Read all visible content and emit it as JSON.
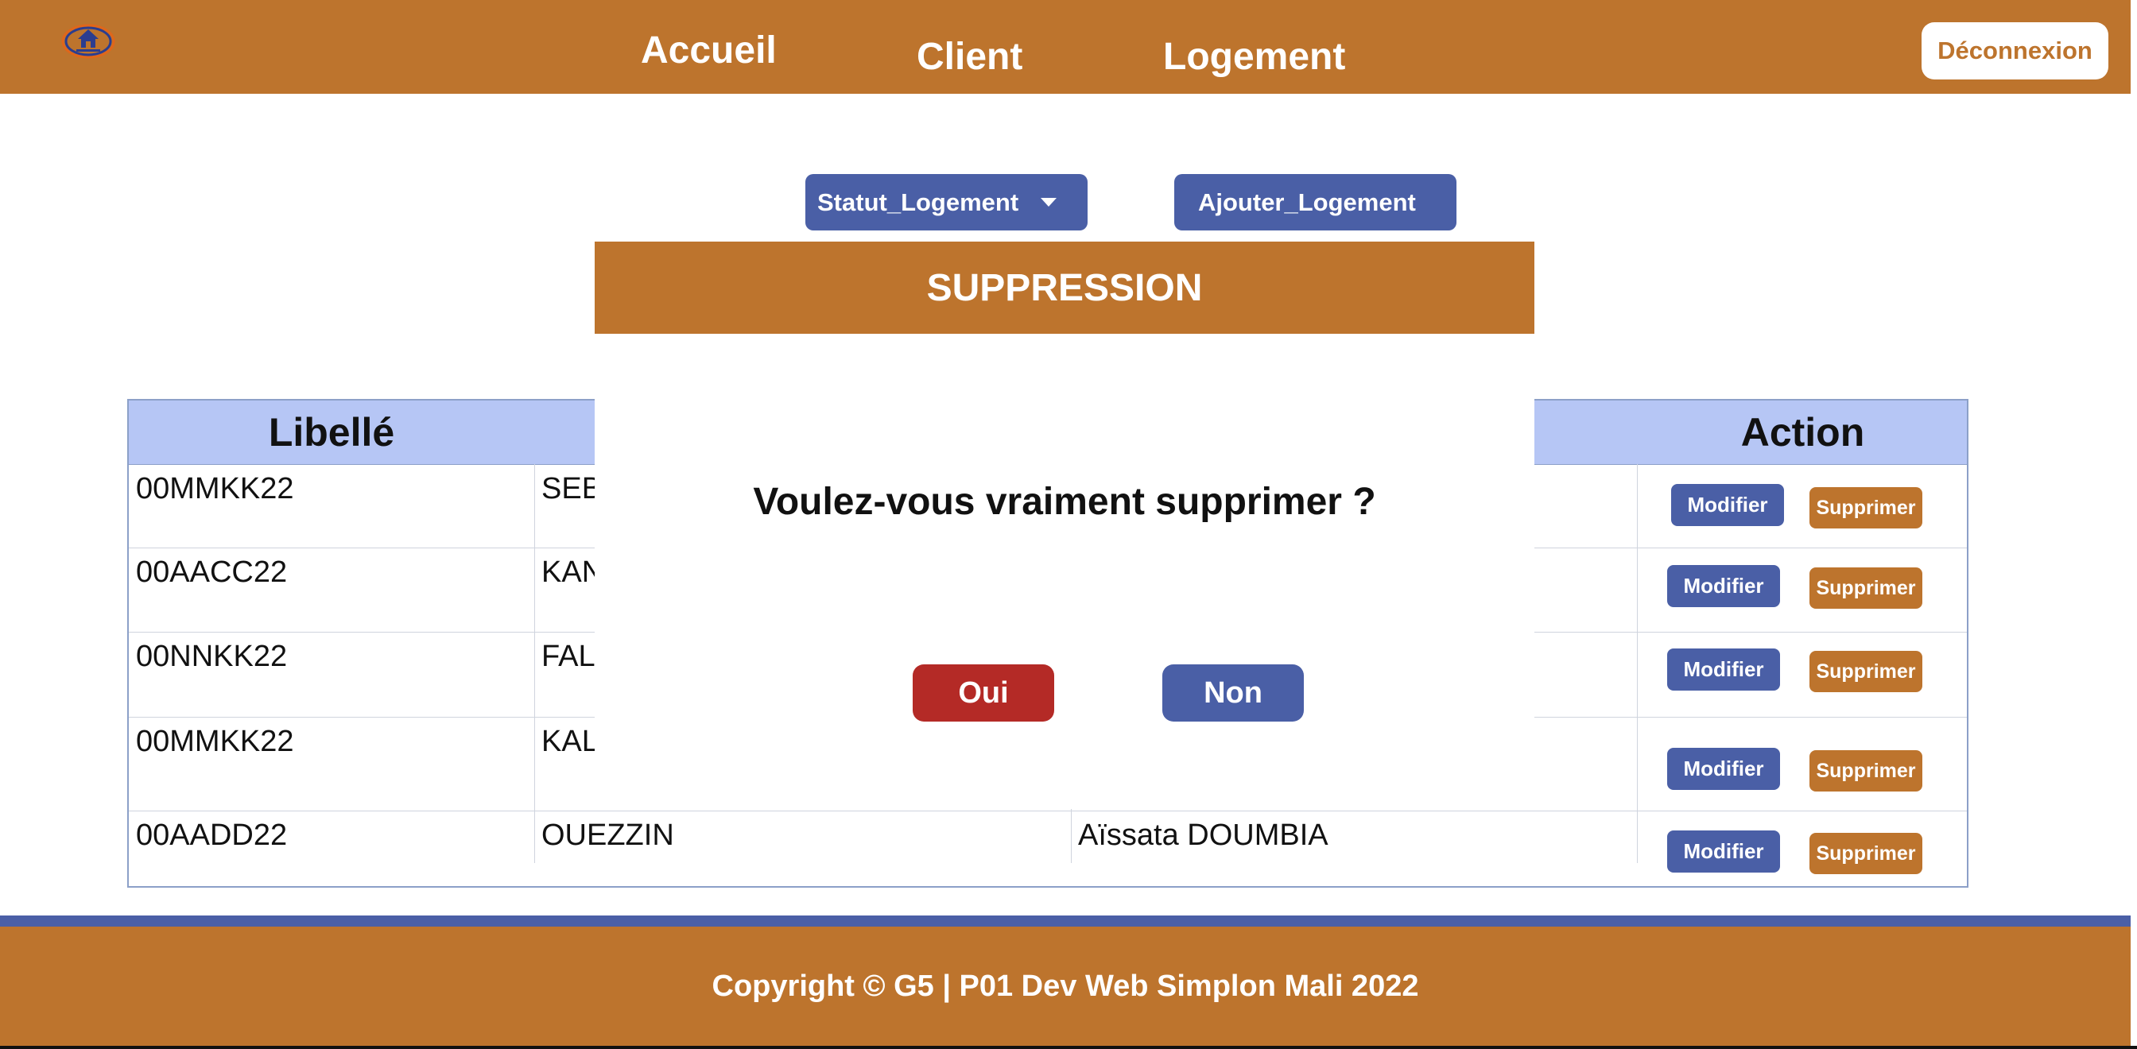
{
  "header": {
    "nav": [
      "Accueil",
      "Client",
      "Logement"
    ],
    "logout": "Déconnexion"
  },
  "toolbar": {
    "status_dropdown": "Statut_Logement",
    "add_button": "Ajouter_Logement"
  },
  "table": {
    "headers": {
      "label": "Libellé",
      "action": "Action"
    },
    "rows": [
      {
        "libelle": "00MMKK22",
        "col2": "SEB",
        "col3": ""
      },
      {
        "libelle": "00AACC22",
        "col2": "KAN",
        "col3": ""
      },
      {
        "libelle": "00NNKK22",
        "col2": "FAL/",
        "col3": ""
      },
      {
        "libelle": "00MMKK22",
        "col2": "KAL",
        "col3": ""
      },
      {
        "libelle": "00AADD22",
        "col2": "OUEZZIN",
        "col3": "Aïssata DOUMBIA"
      }
    ],
    "modify_label": "Modifier",
    "delete_label": "Supprimer"
  },
  "modal": {
    "title": "SUPPRESSION",
    "question": "Voulez-vous vraiment supprimer ?",
    "yes": "Oui",
    "no": "Non"
  },
  "footer": {
    "copyright": "Copyright © G5 | P01 Dev Web Simplon Mali 2022"
  },
  "colors": {
    "brand_orange": "#bd742d",
    "brand_blue": "#4a5fa6",
    "header_blue": "#b6c6f5",
    "danger_red": "#b42a26"
  }
}
